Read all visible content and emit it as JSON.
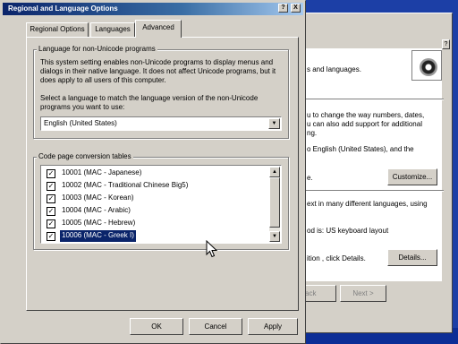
{
  "dialog": {
    "title": "Regional and Language Options",
    "help_btn": "?",
    "close_btn": "X",
    "tabs": [
      {
        "label": "Regional Options",
        "active": false
      },
      {
        "label": "Languages",
        "active": false
      },
      {
        "label": "Advanced",
        "active": true
      }
    ],
    "non_unicode": {
      "group_label": "Language for non-Unicode programs",
      "description": "This system setting enables non-Unicode programs to display menus and dialogs in their native language. It does not affect Unicode programs, but it does apply to all users of this computer.",
      "select_prompt": "Select a language to match the language version of the non-Unicode programs you want to use:",
      "selected_language": "English (United States)"
    },
    "codepages": {
      "group_label": "Code page conversion tables",
      "items": [
        {
          "label": "10001 (MAC - Japanese)",
          "checked": true
        },
        {
          "label": "10002 (MAC - Traditional Chinese Big5)",
          "checked": true
        },
        {
          "label": "10003 (MAC - Korean)",
          "checked": true
        },
        {
          "label": "10004 (MAC - Arabic)",
          "checked": true
        },
        {
          "label": "10005 (MAC - Hebrew)",
          "checked": true
        },
        {
          "label": "10006 (MAC - Greek I)",
          "checked": true,
          "selected": true
        }
      ]
    },
    "buttons": {
      "ok": "OK",
      "cancel": "Cancel",
      "apply": "Apply"
    }
  },
  "background_dialog": {
    "help_btn": "?",
    "line1": "s and languages.",
    "line2": "u to change the way numbers, dates,",
    "line3": "u can also add support for additional",
    "line4": "ng.",
    "line5": "o English (United States), and the",
    "line6": "e.",
    "customize_button": "Customize...",
    "line7": "ext in many different languages, using",
    "line8": "od is: US keyboard layout",
    "line9": "ition , click Details.",
    "details_button": "Details...",
    "back_button": "ack",
    "next_button": "Next >"
  }
}
